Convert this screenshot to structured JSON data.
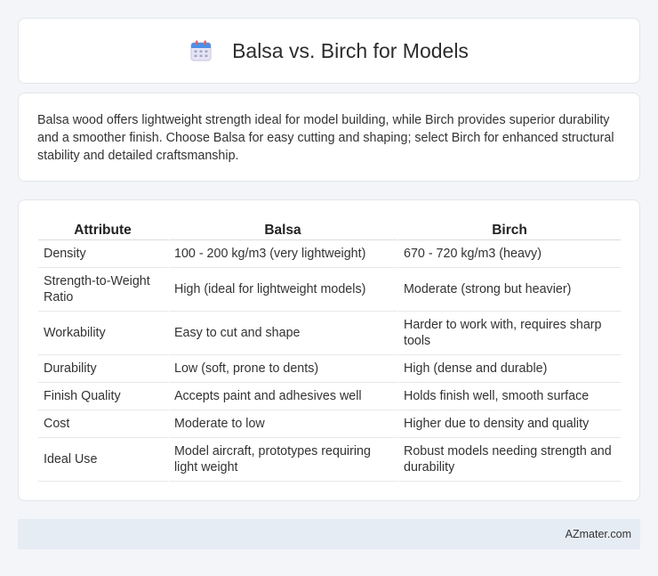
{
  "header": {
    "title": "Balsa vs. Birch for Models",
    "icon": "calendar-icon"
  },
  "intro": {
    "text": "Balsa wood offers lightweight strength ideal for model building, while Birch provides superior durability and a smoother finish. Choose Balsa for easy cutting and shaping; select Birch for enhanced structural stability and detailed craftsmanship."
  },
  "table": {
    "headers": [
      "Attribute",
      "Balsa",
      "Birch"
    ],
    "rows": [
      [
        "Density",
        "100 - 200 kg/m3 (very lightweight)",
        "670 - 720 kg/m3 (heavy)"
      ],
      [
        "Strength-to-Weight Ratio",
        "High (ideal for lightweight models)",
        "Moderate (strong but heavier)"
      ],
      [
        "Workability",
        "Easy to cut and shape",
        "Harder to work with, requires sharp tools"
      ],
      [
        "Durability",
        "Low (soft, prone to dents)",
        "High (dense and durable)"
      ],
      [
        "Finish Quality",
        "Accepts paint and adhesives well",
        "Holds finish well, smooth surface"
      ],
      [
        "Cost",
        "Moderate to low",
        "Higher due to density and quality"
      ],
      [
        "Ideal Use",
        "Model aircraft, prototypes requiring light weight",
        "Robust models needing strength and durability"
      ]
    ]
  },
  "footer": {
    "site": "AZmater.com"
  }
}
